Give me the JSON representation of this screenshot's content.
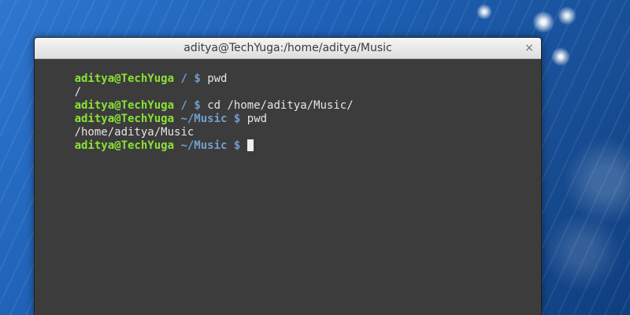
{
  "window": {
    "title": "aditya@TechYuga:/home/aditya/Music",
    "close_symbol": "×"
  },
  "terminal": {
    "lines": [
      {
        "type": "prompt",
        "user": "aditya@TechYuga",
        "path": "/",
        "symbol": "$",
        "command": "pwd"
      },
      {
        "type": "output",
        "text": "/"
      },
      {
        "type": "prompt",
        "user": "aditya@TechYuga",
        "path": "/",
        "symbol": "$",
        "command": "cd /home/aditya/Music/"
      },
      {
        "type": "prompt",
        "user": "aditya@TechYuga",
        "path": "~/Music",
        "symbol": "$",
        "command": "pwd"
      },
      {
        "type": "output",
        "text": "/home/aditya/Music"
      },
      {
        "type": "prompt",
        "user": "aditya@TechYuga",
        "path": "~/Music",
        "symbol": "$",
        "command": ""
      }
    ]
  },
  "colors": {
    "prompt_user": "#8ae234",
    "prompt_path": "#729fcf",
    "terminal_bg": "#3c3c3c",
    "text": "#e6e6e6"
  }
}
